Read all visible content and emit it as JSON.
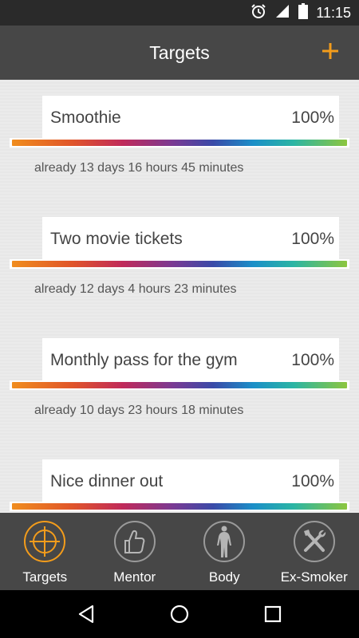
{
  "status_bar": {
    "time": "11:15",
    "icons": [
      "alarm-icon",
      "signal-icon",
      "battery-icon"
    ]
  },
  "toolbar": {
    "title": "Targets",
    "add_icon": "plus-icon",
    "accent_color": "#f39c1b"
  },
  "targets": [
    {
      "name": "Smoothie",
      "percent": "100%",
      "progress": 1.0,
      "elapsed": "already 13 days 16 hours 45 minutes"
    },
    {
      "name": "Two movie tickets",
      "percent": "100%",
      "progress": 1.0,
      "elapsed": "already 12 days 4 hours 23 minutes"
    },
    {
      "name": "Monthly pass for the gym",
      "percent": "100%",
      "progress": 1.0,
      "elapsed": "already 10 days 23 hours 18 minutes"
    },
    {
      "name": "Nice dinner out",
      "percent": "100%",
      "progress": 1.0,
      "elapsed": ""
    }
  ],
  "bottom_nav": {
    "items": [
      {
        "label": "Targets",
        "icon": "crosshair-icon",
        "active": true
      },
      {
        "label": "Mentor",
        "icon": "thumbs-up-icon",
        "active": false
      },
      {
        "label": "Body",
        "icon": "body-icon",
        "active": false
      },
      {
        "label": "Ex-Smoker",
        "icon": "tools-icon",
        "active": false
      }
    ]
  },
  "system_nav": {
    "icons": [
      "back-icon",
      "home-icon",
      "recents-icon"
    ]
  }
}
